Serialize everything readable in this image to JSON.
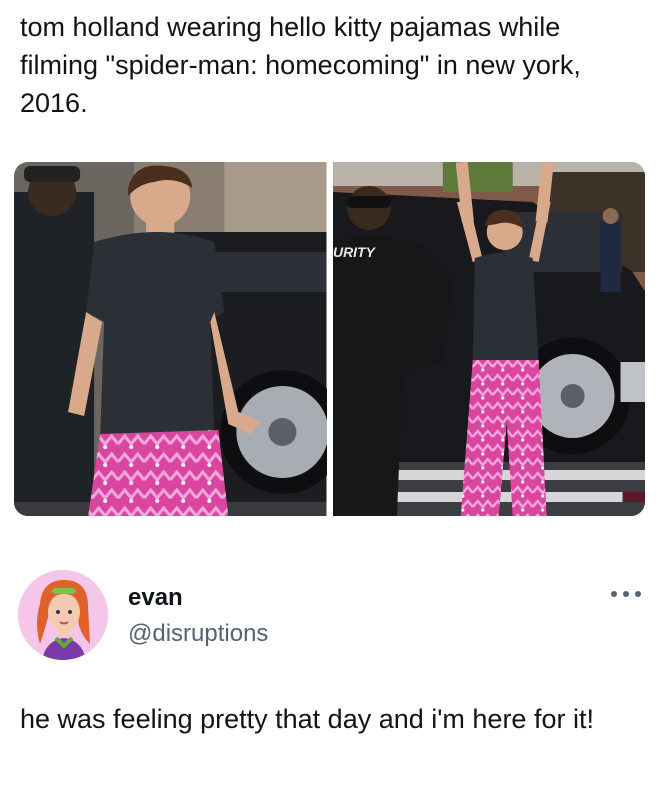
{
  "post": {
    "caption": "tom holland wearing hello kitty pajamas while filming \"spider-man: homecoming\" in new york, 2016."
  },
  "photos": {
    "left_alt": "photo-left",
    "right_sign_text": "URITY"
  },
  "tweet": {
    "display_name": "evan",
    "handle": "@disruptions",
    "text": "he was feeling pretty that day and i'm here for it!",
    "more_icon": "ellipsis-icon"
  },
  "colors": {
    "text": "#0f1419",
    "secondary": "#536471",
    "pants_pink": "#e04fb4"
  }
}
